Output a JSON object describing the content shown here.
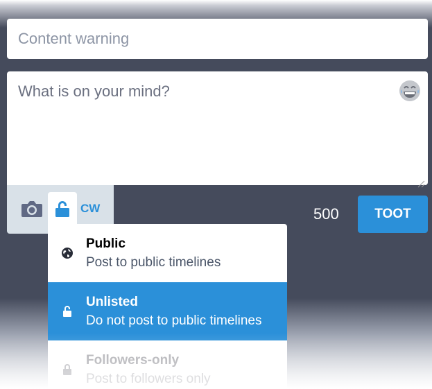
{
  "compose": {
    "content_warning_placeholder": "Content warning",
    "text_placeholder": "What is on your mind?",
    "emoji_icon": "laughing-emoji-icon",
    "character_counter": "500",
    "toot_label": "TOOT",
    "cw_label": "CW"
  },
  "toolbar": {
    "camera_icon": "camera-icon",
    "privacy_icon": "unlock-icon"
  },
  "privacy_dropdown": {
    "options": [
      {
        "icon": "globe-icon",
        "title": "Public",
        "description": "Post to public timelines",
        "active": false
      },
      {
        "icon": "unlock-icon",
        "title": "Unlisted",
        "description": "Do not post to public timelines",
        "active": true
      },
      {
        "icon": "lock-icon",
        "title": "Followers-only",
        "description": "Post to followers only",
        "active": false
      }
    ]
  },
  "colors": {
    "accent": "#2b90d9",
    "background": "#454b5c",
    "toolbar": "#d9e1e8"
  }
}
